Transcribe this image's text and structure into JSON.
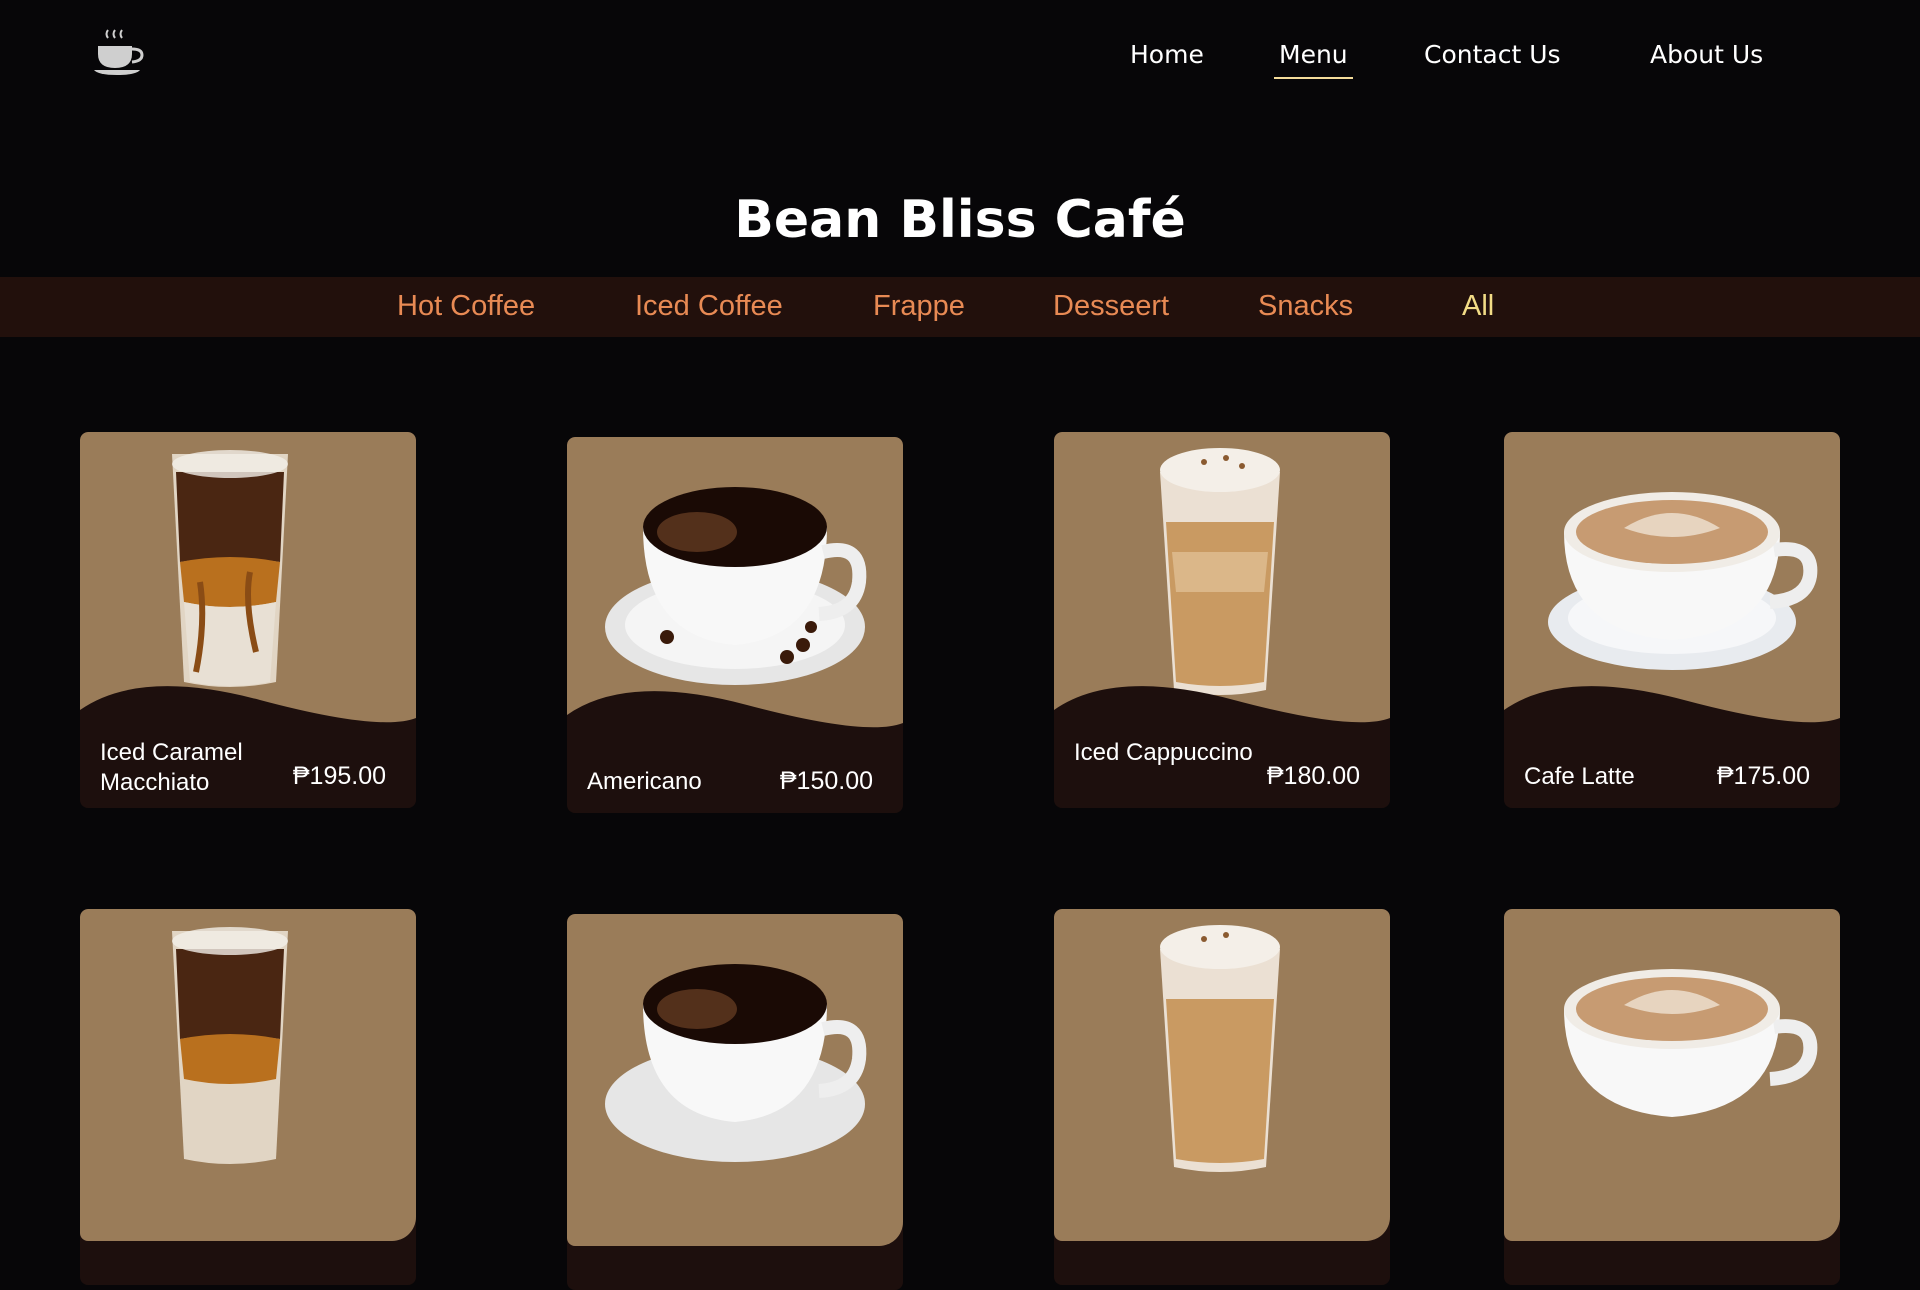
{
  "header": {
    "logo_icon": "coffee-cup-icon",
    "nav": [
      {
        "label": "Home",
        "active": false
      },
      {
        "label": "Menu",
        "active": true
      },
      {
        "label": "Contact Us",
        "active": false
      },
      {
        "label": "About Us",
        "active": false
      }
    ]
  },
  "page_title": "Bean Bliss Café",
  "categories": [
    {
      "label": "Hot Coffee",
      "active": false
    },
    {
      "label": "Iced Coffee",
      "active": false
    },
    {
      "label": "Frappe",
      "active": false
    },
    {
      "label": "Desseert",
      "active": false
    },
    {
      "label": "Snacks",
      "active": false
    },
    {
      "label": "All",
      "active": true
    }
  ],
  "menu_items": [
    {
      "name": "Iced Caramel Macchiato",
      "price": "₱195.00",
      "image": "iced-caramel-macchiato"
    },
    {
      "name": "Americano",
      "price": "₱150.00",
      "image": "americano"
    },
    {
      "name": "Iced Cappuccino",
      "price": "₱180.00",
      "image": "iced-cappuccino"
    },
    {
      "name": "Cafe Latte",
      "price": "₱175.00",
      "image": "cafe-latte"
    },
    {
      "name": "",
      "price": "",
      "image": "iced-caramel-macchiato"
    },
    {
      "name": "",
      "price": "",
      "image": "americano"
    },
    {
      "name": "",
      "price": "",
      "image": "iced-cappuccino"
    },
    {
      "name": "",
      "price": "",
      "image": "cafe-latte"
    }
  ],
  "colors": {
    "background": "#070608",
    "category_bar": "#22100c",
    "category_text": "#e88a54",
    "category_active": "#f2dc86",
    "card_top": "#9a7c59",
    "card_bottom": "#1d0f0d"
  }
}
